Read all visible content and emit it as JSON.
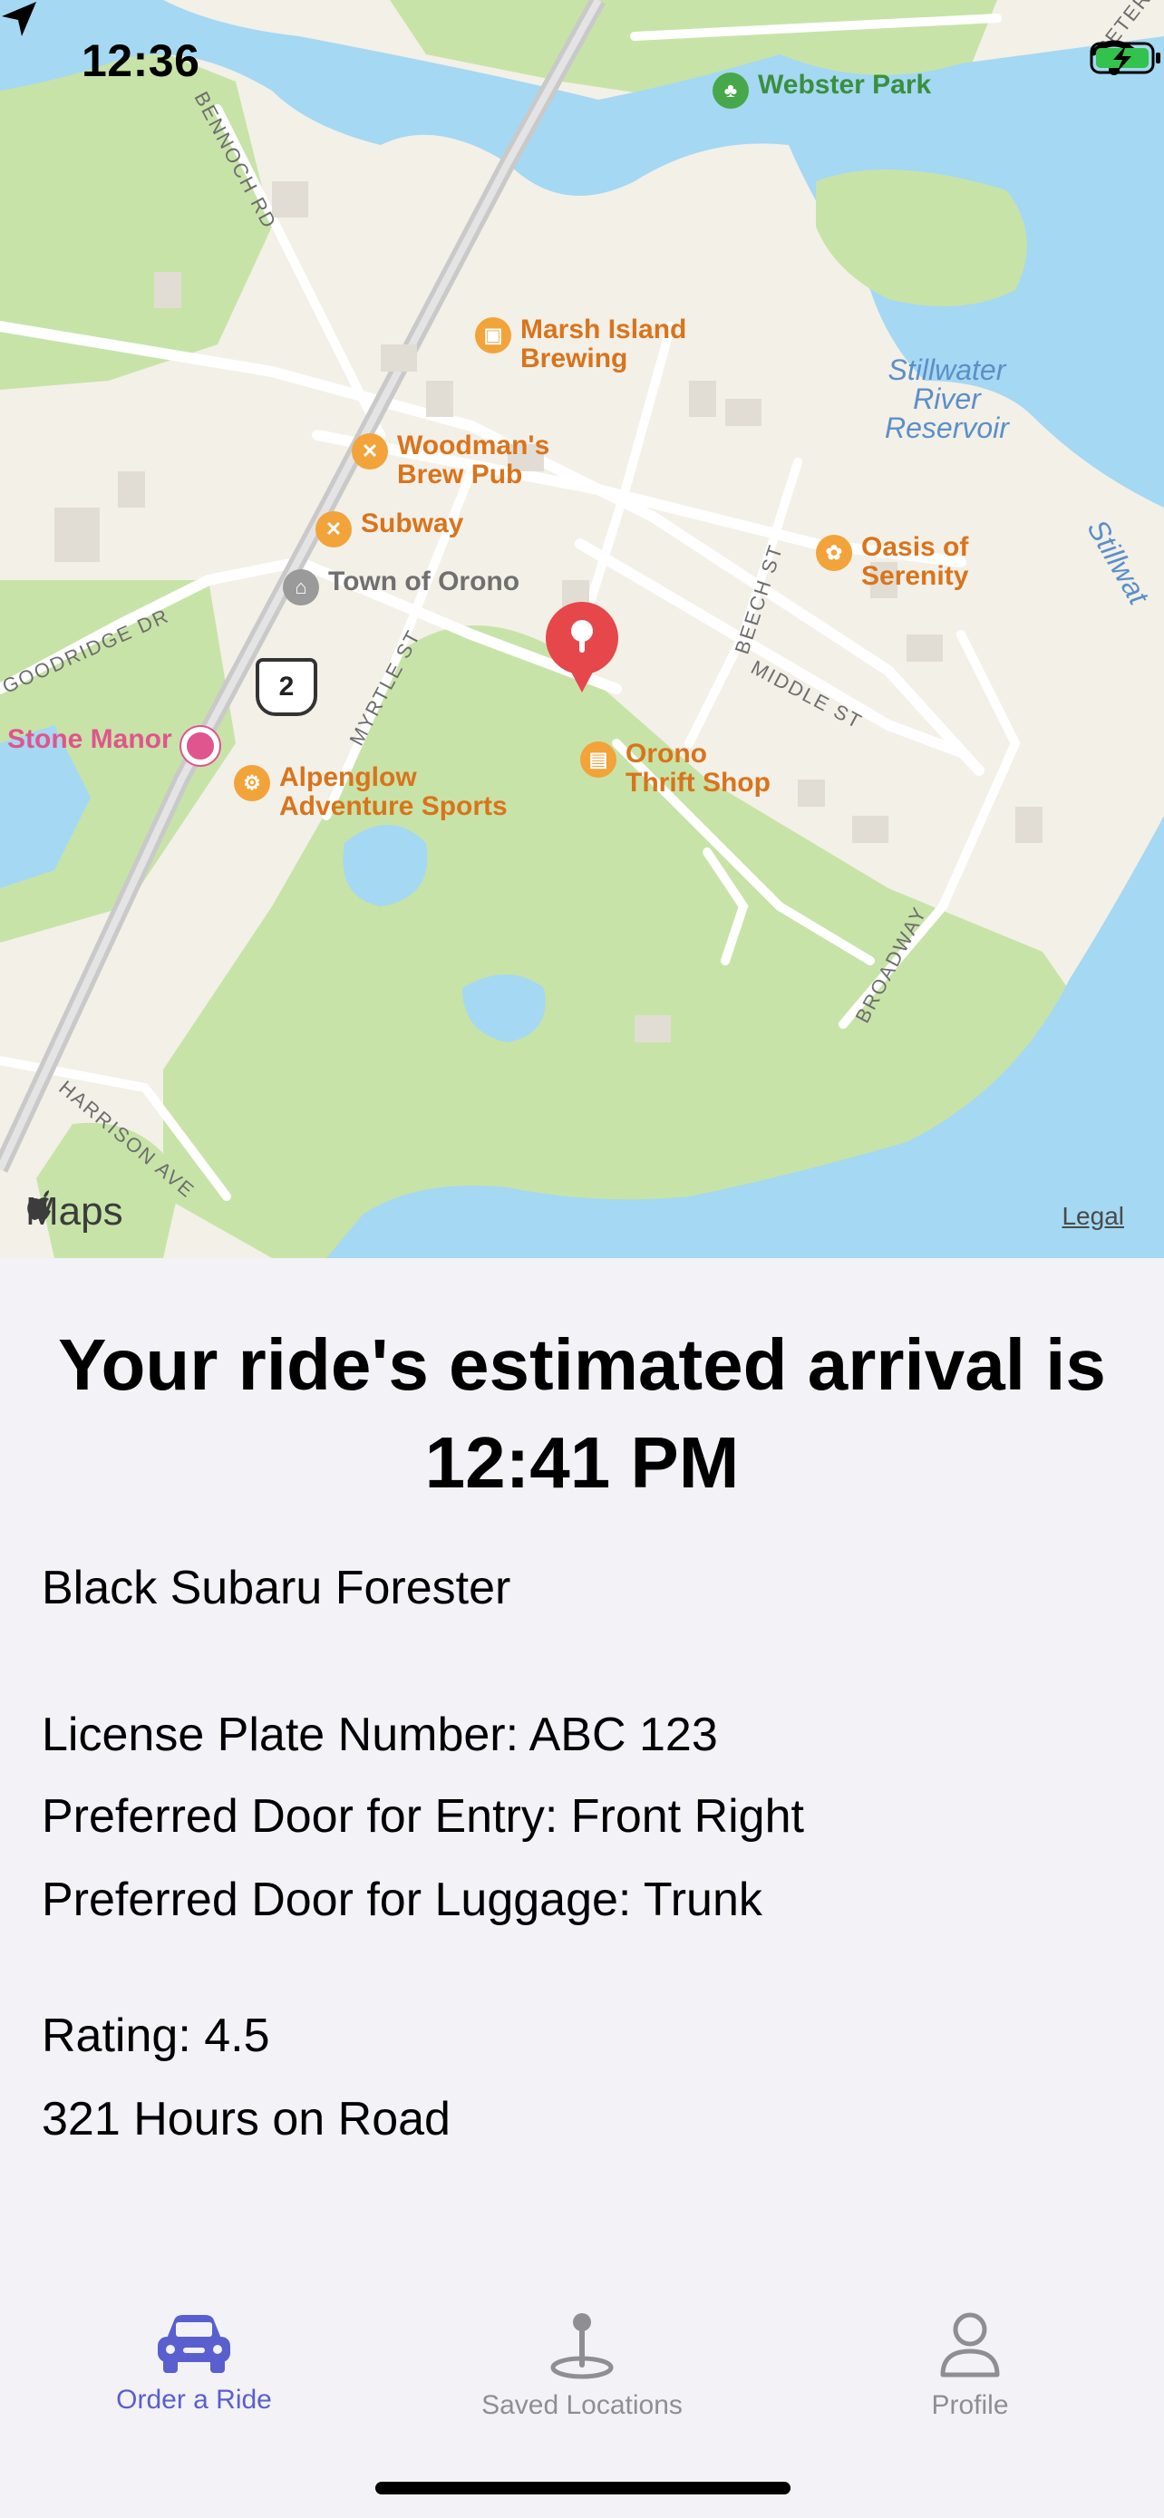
{
  "status_bar": {
    "time": "12:36"
  },
  "map": {
    "pois": [
      {
        "name": "Webster Park",
        "kind": "park"
      },
      {
        "name": "Marsh Island\nBrewing",
        "kind": "brewery"
      },
      {
        "name": "Woodman's\nBrew Pub",
        "kind": "restaurant"
      },
      {
        "name": "Subway",
        "kind": "restaurant"
      },
      {
        "name": "Town of Orono",
        "kind": "civic"
      },
      {
        "name": "Oasis of\nSerenity",
        "kind": "spa"
      },
      {
        "name": "Stone Manor",
        "kind": "lodging"
      },
      {
        "name": "Alpenglow\nAdventure Sports",
        "kind": "store"
      },
      {
        "name": "Orono\nThrift Shop",
        "kind": "store"
      }
    ],
    "streets": [
      "BENNOCH RD",
      "GOODRIDGE DR",
      "MYRTLE ST",
      "BEECH ST",
      "MIDDLE ST",
      "BROADWAY",
      "HARRISON AVE",
      "PETER"
    ],
    "water_labels": [
      "Stillwater\nRiver\nReservoir",
      "Stillwat"
    ],
    "route_shield": "2",
    "attribution": "Maps",
    "legal": "Legal",
    "colors": {
      "water": "#a5d8f2",
      "park": "#c8e3a8",
      "land": "#f3f0e8",
      "road": "#ffffff",
      "highway": "#c9c9c9",
      "pin": "#e5474b"
    }
  },
  "ride": {
    "arrival_text": "Your ride's estimated arrival is 12:41 PM",
    "vehicle": "Black Subaru Forester",
    "license_plate": "License Plate Number: ABC 123",
    "entry_door": "Preferred Door for Entry: Front Right",
    "luggage_door": "Preferred Door for Luggage: Trunk",
    "rating": "Rating: 4.5",
    "hours": "321 Hours on Road"
  },
  "tabbar": {
    "accent": "#5a5fcf",
    "inactive": "#8e8e93",
    "tabs": [
      {
        "label": "Order a Ride",
        "icon": "car-icon",
        "active": true
      },
      {
        "label": "Saved Locations",
        "icon": "map-pin-icon",
        "active": false
      },
      {
        "label": "Profile",
        "icon": "person-icon",
        "active": false
      }
    ]
  }
}
